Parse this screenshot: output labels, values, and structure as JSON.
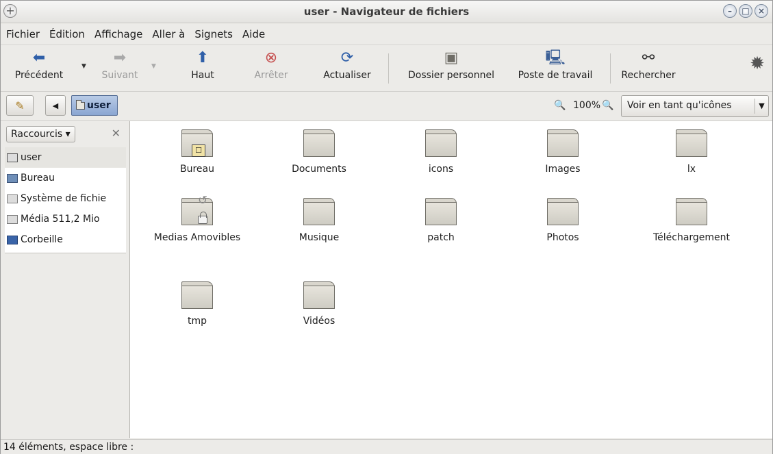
{
  "window": {
    "title": "user - Navigateur de fichiers"
  },
  "menubar": {
    "items": [
      "Fichier",
      "Édition",
      "Affichage",
      "Aller à",
      "Signets",
      "Aide"
    ]
  },
  "toolbar": {
    "back": "Précédent",
    "forward": "Suivant",
    "up": "Haut",
    "stop": "Arrêter",
    "reload": "Actualiser",
    "home": "Dossier personnel",
    "computer": "Poste de travail",
    "search": "Rechercher"
  },
  "location": {
    "crumb": "user",
    "zoom": "100%",
    "view_mode": "Voir en tant qu'icônes"
  },
  "sidebar": {
    "header": "Raccourcis",
    "items": [
      {
        "label": "user",
        "icon": "folder-icon"
      },
      {
        "label": "Bureau",
        "icon": "desktop-icon"
      },
      {
        "label": "Système de fichie",
        "icon": "drive-icon"
      },
      {
        "label": "Média 511,2 Mio",
        "icon": "drive-icon"
      },
      {
        "label": "Corbeille",
        "icon": "trash-icon"
      }
    ]
  },
  "files": [
    {
      "name": "Bureau",
      "emblem": "desktop"
    },
    {
      "name": "Documents"
    },
    {
      "name": "icons"
    },
    {
      "name": "Images"
    },
    {
      "name": "lx"
    },
    {
      "name": "Medias Amovibles",
      "emblem": "link-lock"
    },
    {
      "name": "Musique"
    },
    {
      "name": "patch"
    },
    {
      "name": "Photos"
    },
    {
      "name": "Téléchargement"
    },
    {
      "name": "tmp"
    },
    {
      "name": "Vidéos"
    }
  ],
  "status": {
    "text": "14 éléments, espace libre :"
  }
}
